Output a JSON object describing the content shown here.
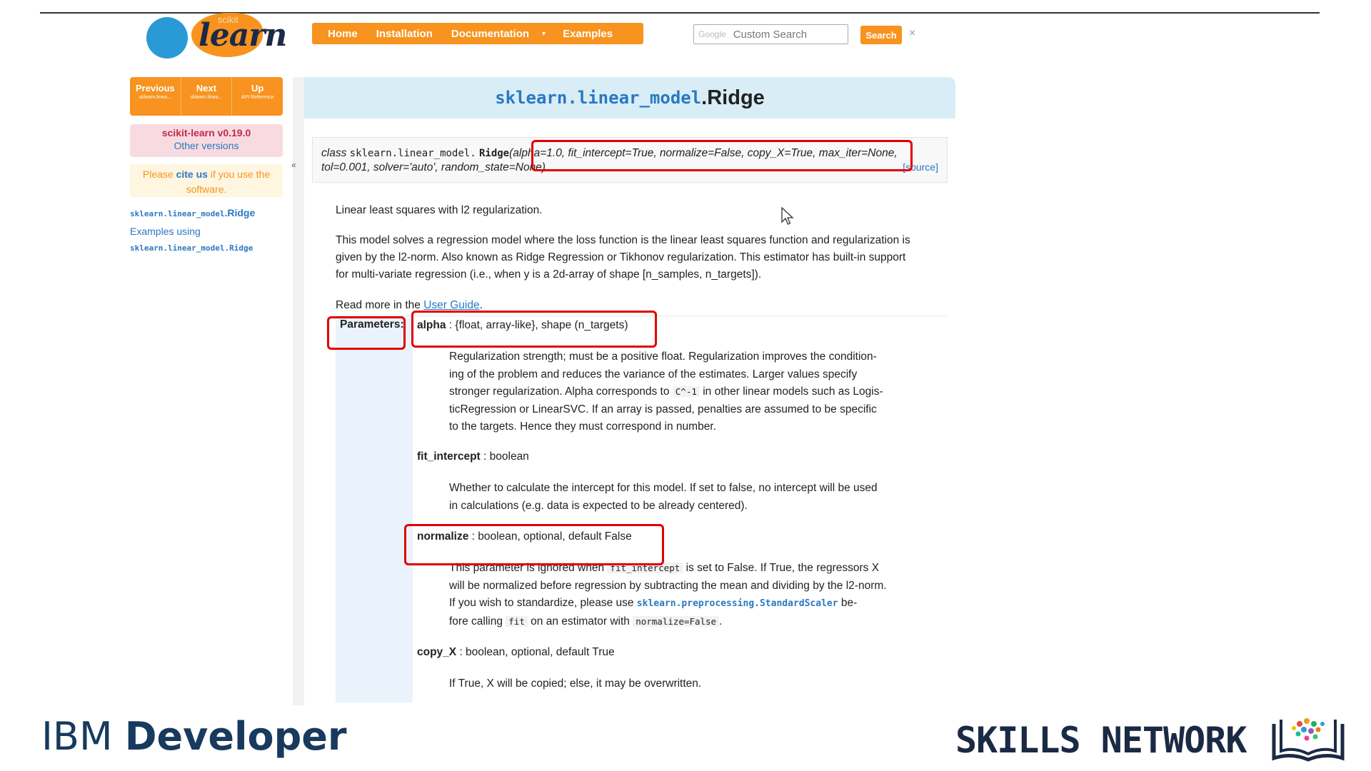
{
  "logo": {
    "top_word": "scikit",
    "main_word": "learn"
  },
  "nav": {
    "items": [
      "Home",
      "Installation",
      "Documentation",
      "Examples"
    ],
    "dropdown_caret": "▾"
  },
  "search": {
    "brand": "Google",
    "placeholder": "Custom Search",
    "button": "Search",
    "clear": "×"
  },
  "sidebar": {
    "rel_nav": [
      {
        "label": "Previous",
        "sub": "sklearn.linea..."
      },
      {
        "label": "Next",
        "sub": "sklearn.linea..."
      },
      {
        "label": "Up",
        "sub": "API Reference"
      }
    ],
    "version": "scikit-learn v0.19.0",
    "other_versions": "Other versions",
    "cite": {
      "pre": "Please",
      "link": "cite us",
      "post": "if you use the software."
    },
    "toc": {
      "item1_mod": "sklearn.linear_model",
      "item1_cls": ".Ridge",
      "item2_text": "Examples using",
      "item2_code": "sklearn.linear_model.Ridge"
    },
    "collapse": "«"
  },
  "title": {
    "module": "sklearn.linear_model",
    "class_name": ".Ridge"
  },
  "signature": {
    "keyword": "class",
    "module": "sklearn.linear_model.",
    "name": "Ridge",
    "args_line1": "(alpha=1.0, fit_intercept=True, normalize=False, copy_X=True, max_iter=None,",
    "args_line2": "tol=0.001, solver='auto', random_state=None)",
    "source": "[source]"
  },
  "intro": {
    "summary": "Linear least squares with l2 regularization.",
    "desc_line1": "This model solves a regression model where the loss function is the linear least squares function and regularization is",
    "desc_line2": "given by the l2-norm. Also known as Ridge Regression or Tikhonov regularization. This estimator has built-in support",
    "desc_line3": "for multi-variate regression (i.e., when y is a 2d-array of shape [n_samples, n_targets]).",
    "read_more_pre": "Read more in the",
    "read_more_link": "User Guide",
    "read_more_post": "."
  },
  "parameters": {
    "label": "Parameters:",
    "alpha": {
      "name": "alpha",
      "type": " : {float, array-like}, shape (n_targets)",
      "lines": [
        "Regularization strength; must be a positive float. Regularization improves the condition-",
        "ing of the problem and reduces the variance of the estimates. Larger values specify",
        "stronger regularization. Alpha corresponds to",
        "C^-1",
        "in other linear models such as Logis-",
        "ticRegression or LinearSVC. If an array is passed, penalties are assumed to be specific",
        "to the targets. Hence they must correspond in number."
      ]
    },
    "fit_intercept": {
      "name": "fit_intercept",
      "type": " : boolean",
      "lines": [
        "Whether to calculate the intercept for this model. If set to false, no intercept will be used",
        "in calculations (e.g. data is expected to be already centered)."
      ]
    },
    "normalize": {
      "name": "normalize",
      "type": " : boolean, optional, default False",
      "l1_pre": "This parameter is ignored when",
      "l1_code": "fit_intercept",
      "l1_post": "is set to False. If True, the regressors X",
      "l2": "will be normalized before regression by subtracting the mean and dividing by the l2-norm.",
      "l3_pre": "If you wish to standardize, please use",
      "l3_link": "sklearn.preprocessing.StandardScaler",
      "l3_post": "be-",
      "l4_pre": "fore calling",
      "l4_code1": "fit",
      "l4_mid": "on an estimator with",
      "l4_code2": "normalize=False",
      "l4_post": "."
    },
    "copy_x": {
      "name": "copy_X",
      "type": " : boolean, optional, default True",
      "line": "If True, X will be copied; else, it may be overwritten."
    }
  },
  "branding": {
    "ibm_light": "IBM",
    "ibm_bold": "Developer",
    "skills": "SKILLS NETWORK"
  },
  "colors": {
    "accent": "#f7931e",
    "link": "#2a78c2",
    "highlight": "#e00000",
    "title_bg": "#d9edf7"
  }
}
